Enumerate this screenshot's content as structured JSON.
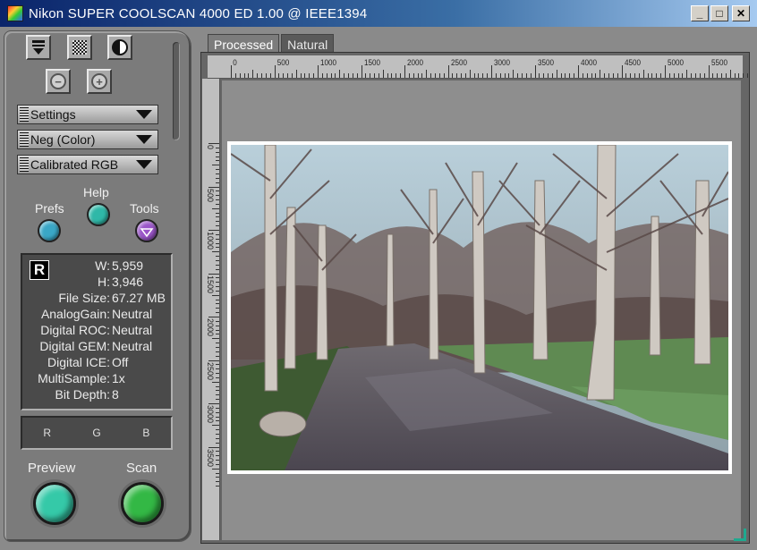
{
  "window": {
    "title": "Nikon SUPER COOLSCAN 4000 ED 1.00 @ IEEE1394",
    "buttons": {
      "minimize": "_",
      "maximize": "□",
      "close": "✕"
    }
  },
  "toolbar": {
    "icons": [
      "film-eject-icon",
      "grain-icon",
      "contrast-icon",
      "zoom-out-icon",
      "zoom-in-icon"
    ],
    "zoom_out_glyph": "−",
    "zoom_in_glyph": "+"
  },
  "dropdowns": {
    "settings": "Settings",
    "film_type": "Neg (Color)",
    "color_space": "Calibrated RGB"
  },
  "round_buttons": {
    "prefs": "Prefs",
    "help": "Help",
    "tools": "Tools"
  },
  "info": {
    "channel_badge": "R",
    "rows": [
      {
        "key": "W:",
        "value": "5,959"
      },
      {
        "key": "H:",
        "value": "3,946"
      },
      {
        "key": "File Size:",
        "value": "67.27 MB"
      },
      {
        "key": "AnalogGain:",
        "value": "Neutral"
      },
      {
        "key": "Digital ROC:",
        "value": "Neutral"
      },
      {
        "key": "Digital GEM:",
        "value": "Neutral"
      },
      {
        "key": "Digital ICE:",
        "value": "Off"
      },
      {
        "key": "MultiSample:",
        "value": "1x"
      },
      {
        "key": "Bit Depth:",
        "value": "8"
      }
    ]
  },
  "rgb_readout": {
    "r": "R",
    "g": "G",
    "b": "B"
  },
  "actions": {
    "preview": "Preview",
    "scan": "Scan"
  },
  "tabs": [
    {
      "label": "Processed",
      "active": true
    },
    {
      "label": "Natural",
      "active": false
    }
  ],
  "ruler": {
    "top_labels": [
      "0",
      "500",
      "1000",
      "1500",
      "2000",
      "2500",
      "3000",
      "3500",
      "4000",
      "4500",
      "5000",
      "5500"
    ],
    "left_labels": [
      "0",
      "500",
      "1000",
      "1500",
      "2000",
      "2500",
      "3000",
      "3500"
    ]
  },
  "colors": {
    "prefs_knob": "#3aa7c6",
    "help_knob": "#2fb8a8",
    "tools_knob": "#9a55c8",
    "preview_button": "#35c9a8",
    "scan_button": "#33b845",
    "resize_corner": "#1fa98f"
  }
}
